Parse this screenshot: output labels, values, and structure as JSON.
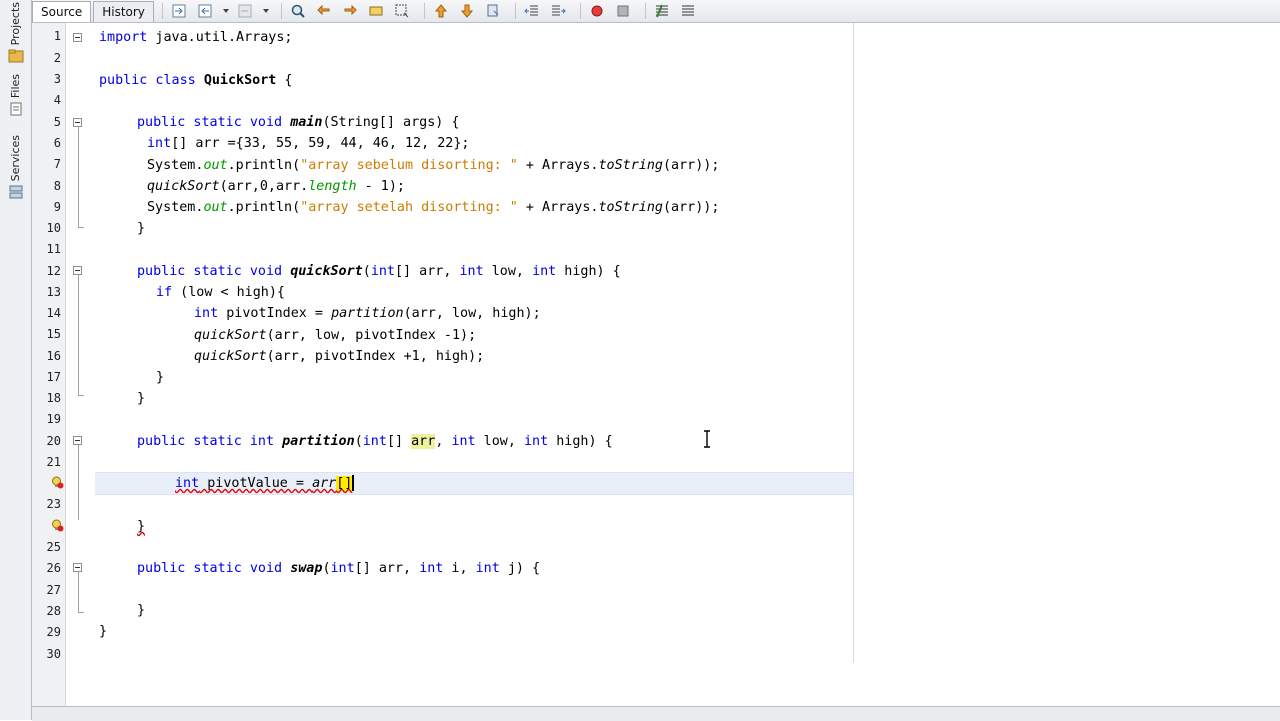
{
  "side_panel": {
    "tabs": [
      {
        "label": "Projects",
        "icon": "projects-icon"
      },
      {
        "label": "Files",
        "icon": "files-icon"
      },
      {
        "label": "Services",
        "icon": "services-icon"
      }
    ]
  },
  "editor_tabs": {
    "source": "Source",
    "history": "History"
  },
  "toolbar_icons": [
    "last-edit-icon",
    "back-icon",
    "forward-icon",
    "find-icon",
    "find-previous-icon",
    "find-next-icon",
    "toggle-highlight-icon",
    "toggle-rectangular-icon",
    "previous-bookmark-icon",
    "next-bookmark-icon",
    "toggle-bookmark-icon",
    "shift-left-icon",
    "shift-right-icon",
    "start-macro-icon",
    "stop-macro-icon",
    "comment-icon",
    "uncomment-icon"
  ],
  "line_numbers": [
    "1",
    "2",
    "3",
    "4",
    "5",
    "6",
    "7",
    "8",
    "9",
    "10",
    "11",
    "12",
    "13",
    "14",
    "15",
    "16",
    "17",
    "18",
    "19",
    "20",
    "21",
    "22",
    "23",
    "24",
    "25",
    "26",
    "27",
    "28",
    "29",
    "30"
  ],
  "code": {
    "l1": {
      "kw": "import",
      "rest": " java.util.Arrays;"
    },
    "l3": {
      "kw": "public class",
      "name": "QuickSort",
      "rest": " {"
    },
    "l5": {
      "kw": "public static void",
      "name": "main",
      "rest": "(String[] args) {"
    },
    "l6": {
      "kw": "int",
      "rest": "[] arr ={33, 55, 59, 44, 46, 12, 22};"
    },
    "l7": {
      "pre": "System.",
      "field": "out",
      "mid": ".println(",
      "str": "\"array sebelum disorting: \"",
      "plus": " + Arrays.",
      "method": "toString",
      "end": "(arr));"
    },
    "l8": {
      "method": "quickSort",
      "mid": "(arr,0,arr.",
      "field": "length",
      "end": " - 1);"
    },
    "l9": {
      "pre": "System.",
      "field": "out",
      "mid": ".println(",
      "str": "\"array setelah disorting: \"",
      "plus": " + Arrays.",
      "method": "toString",
      "end": "(arr));"
    },
    "l10": {
      "text": "}"
    },
    "l12": {
      "kw": "public static void",
      "name": "quickSort",
      "p1": "(",
      "k1": "int",
      "p2": "[] arr, ",
      "k2": "int",
      "p3": " low, ",
      "k3": "int",
      "p4": " high) {"
    },
    "l13": {
      "kw": "if",
      "rest": " (low < high){"
    },
    "l14": {
      "kw": "int",
      "mid": " pivotIndex = ",
      "method": "partition",
      "end": "(arr, low, high);"
    },
    "l15": {
      "method": "quickSort",
      "end": "(arr, low, pivotIndex -1);"
    },
    "l16": {
      "method": "quickSort",
      "end": "(arr, pivotIndex +1, high);"
    },
    "l17": {
      "text": "}"
    },
    "l18": {
      "text": "}"
    },
    "l20": {
      "kw": "public static int",
      "name": "partition",
      "p1": "(",
      "k1": "int",
      "p2": "[] ",
      "hl": "arr",
      "p3": ", ",
      "k2": "int",
      "p4": " low, ",
      "k3": "int",
      "p5": " high) {"
    },
    "l22": {
      "kw": "int",
      "mid": " pivotValue = ",
      "var": "arr",
      "bracket": "[]"
    },
    "l24": {
      "text": "}"
    },
    "l26": {
      "kw": "public static void",
      "name": "swap",
      "p1": "(",
      "k1": "int",
      "p2": "[] arr, ",
      "k2": "int",
      "p3": " i, ",
      "k3": "int",
      "p4": " j) {"
    },
    "l28": {
      "text": "}"
    },
    "l29": {
      "text": "}"
    }
  }
}
